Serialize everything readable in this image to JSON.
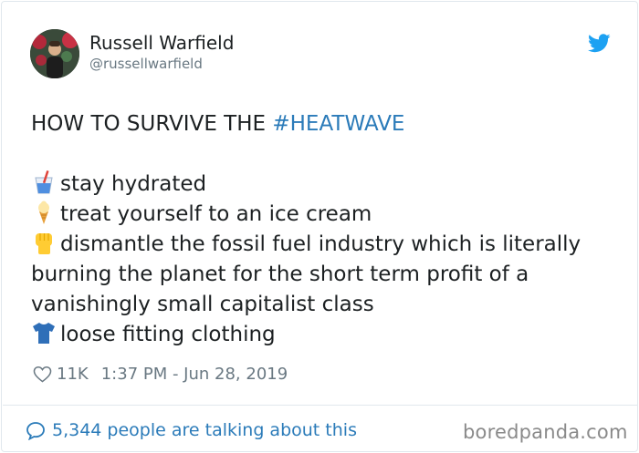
{
  "author": {
    "display_name": "Russell Warfield",
    "handle": "@russellwarfield"
  },
  "tweet": {
    "lead_text": "HOW TO SURVIVE THE ",
    "hashtag": "#HEATWAVE",
    "items": [
      {
        "icon": "tropical-drink-icon",
        "text": "stay hydrated"
      },
      {
        "icon": "ice-cream-icon",
        "text": "treat yourself to an ice cream"
      },
      {
        "icon": "raised-fist-icon",
        "text_lines": [
          "dismantle the fossil fuel industry which is literally",
          "burning the planet for the short term profit of a",
          "vanishingly small capitalist class"
        ]
      },
      {
        "icon": "t-shirt-icon",
        "text": "loose fitting clothing"
      }
    ]
  },
  "meta": {
    "likes": "11K",
    "timestamp": "1:37 PM - Jun 28, 2019"
  },
  "footer": {
    "talking": "5,344 people are talking about this"
  },
  "watermark": "boredpanda.com",
  "colors": {
    "link": "#2b7bb9",
    "secondary_text": "#697882",
    "twitter_blue": "#1da1f2"
  }
}
